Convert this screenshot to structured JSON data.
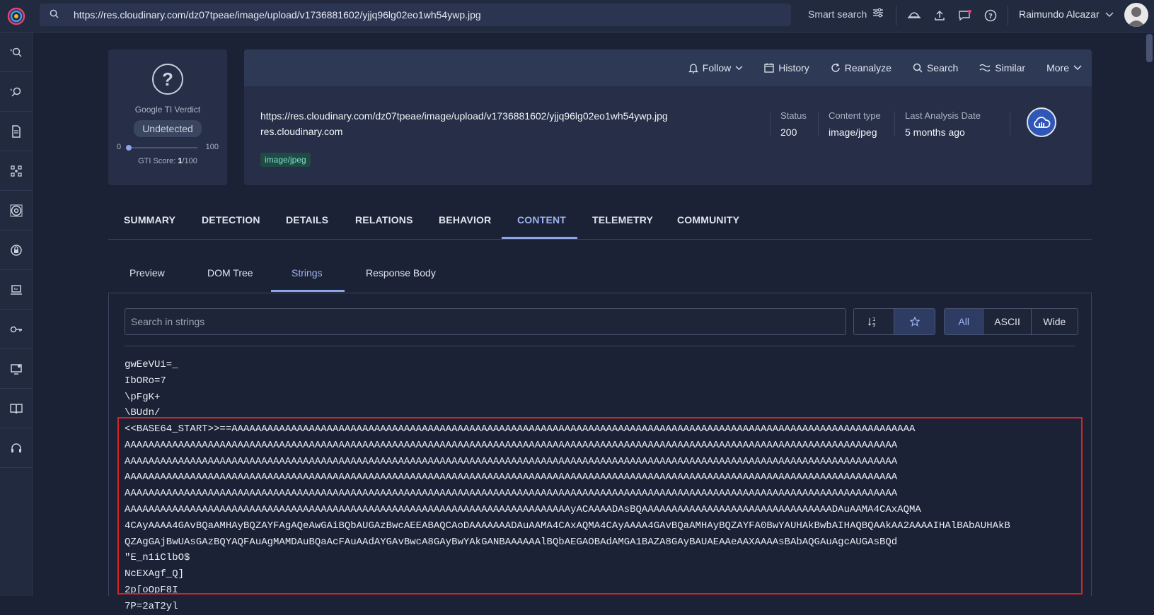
{
  "topbar": {
    "url": "https://res.cloudinary.com/dz07tpeae/image/upload/v1736881602/yjjq96lg02eo1wh54ywp.jpg",
    "smart_search": "Smart search",
    "user_name": "Raimundo Alcazar"
  },
  "verdict": {
    "label": "Google TI Verdict",
    "value": "Undetected",
    "range_min": "0",
    "range_max": "100",
    "score_prefix": "GTI Score: ",
    "score": "1",
    "score_suffix": "/100",
    "score_fraction": 0.01
  },
  "actions": {
    "follow": "Follow",
    "history": "History",
    "reanalyze": "Reanalyze",
    "search": "Search",
    "similar": "Similar",
    "more": "More"
  },
  "info": {
    "url": "https://res.cloudinary.com/dz07tpeae/image/upload/v1736881602/yjjq96lg02eo1wh54ywp.jpg",
    "domain": "res.cloudinary.com",
    "tag": "image/jpeg",
    "status_label": "Status",
    "status_value": "200",
    "content_type_label": "Content type",
    "content_type_value": "image/jpeg",
    "last_analysis_label": "Last Analysis Date",
    "last_analysis_value": "5 months ago"
  },
  "tabs": [
    "SUMMARY",
    "DETECTION",
    "DETAILS",
    "RELATIONS",
    "BEHAVIOR",
    "CONTENT",
    "TELEMETRY",
    "COMMUNITY"
  ],
  "active_tab": "CONTENT",
  "subtabs": [
    "Preview",
    "DOM Tree",
    "Strings",
    "Response Body"
  ],
  "active_subtab": "Strings",
  "strings_panel": {
    "search_placeholder": "Search in strings",
    "filter_all": "All",
    "filter_ascii": "ASCII",
    "filter_wide": "Wide",
    "lines_before": [
      "gwEeVUi=_",
      "IbORo=7",
      "\\pFgK+",
      "\\BUdn/"
    ],
    "highlighted_lines": [
      "<<BASE64_START>>==AAAAAAAAAAAAAAAAAAAAAAAAAAAAAAAAAAAAAAAAAAAAAAAAAAAAAAAAAAAAAAAAAAAAAAAAAAAAAAAAAAAAAAAAAAAAAAAAAAAAAAAAAAAAAAAAAAA",
      "AAAAAAAAAAAAAAAAAAAAAAAAAAAAAAAAAAAAAAAAAAAAAAAAAAAAAAAAAAAAAAAAAAAAAAAAAAAAAAAAAAAAAAAAAAAAAAAAAAAAAAAAAAAAAAAAAAAAAAAAAAAAAAAAAA",
      "AAAAAAAAAAAAAAAAAAAAAAAAAAAAAAAAAAAAAAAAAAAAAAAAAAAAAAAAAAAAAAAAAAAAAAAAAAAAAAAAAAAAAAAAAAAAAAAAAAAAAAAAAAAAAAAAAAAAAAAAAAAAAAAAAA",
      "AAAAAAAAAAAAAAAAAAAAAAAAAAAAAAAAAAAAAAAAAAAAAAAAAAAAAAAAAAAAAAAAAAAAAAAAAAAAAAAAAAAAAAAAAAAAAAAAAAAAAAAAAAAAAAAAAAAAAAAAAAAAAAAAAA",
      "AAAAAAAAAAAAAAAAAAAAAAAAAAAAAAAAAAAAAAAAAAAAAAAAAAAAAAAAAAAAAAAAAAAAAAAAAAAAAAAAAAAAAAAAAAAAAAAAAAAAAAAAAAAAAAAAAAAAAAAAAAAAAAAAAA",
      "AAAAAAAAAAAAAAAAAAAAAAAAAAAAAAAAAAAAAAAAAAAAAAAAAAAAAAAAAAAAAAAAAAAAAAAAAAAyACAAAADAsBQAAAAAAAAAAAAAAAAAAAAAAAAAAAAAAAADAuAAMA4CAxAQMA",
      "4CAyAAAA4GAvBQaAMHAyBQZAYFAgAQeAwGAiBQbAUGAzBwcAEEABAQCAoDAAAAAAADAuAAMA4CAxAQMA4CAyAAAA4GAvBQaAMHAyBQZAYFA0BwYAUHAkBwbAIHAQBQAAkAA2AAAAIHAlBAbAUHAkB",
      "QZAgGAjBwUAsGAzBQYAQFAuAgMAMDAuBQaAcFAuAAdAYGAvBwcA8GAyBwYAkGANBAAAAAAlBQbAEGAOBAdAMGA1BAZA8GAyBAUAEAAeAAXAAAAsBAbAQGAuAgcAUGAsBQd",
      "\"E_n1iClbO$",
      "NcEXAgf_Q]",
      "2p[oOpF8I",
      "7P=2aT2yl"
    ]
  },
  "colors": {
    "page_bg": "#1b2236",
    "card_bg": "#262f47",
    "accent": "#8ea4e8",
    "highlight_border": "#d42424",
    "tag_bg": "#1f4a45"
  },
  "icons": {
    "logo": "virustotal-logo-icon",
    "search": "search-icon",
    "filter": "sliders-icon",
    "hat": "incognito-icon",
    "upload": "upload-icon",
    "chat": "chat-icon",
    "help": "help-icon",
    "verdict": "question-circle-icon",
    "provider": "cloudinary-cloud-icon"
  }
}
